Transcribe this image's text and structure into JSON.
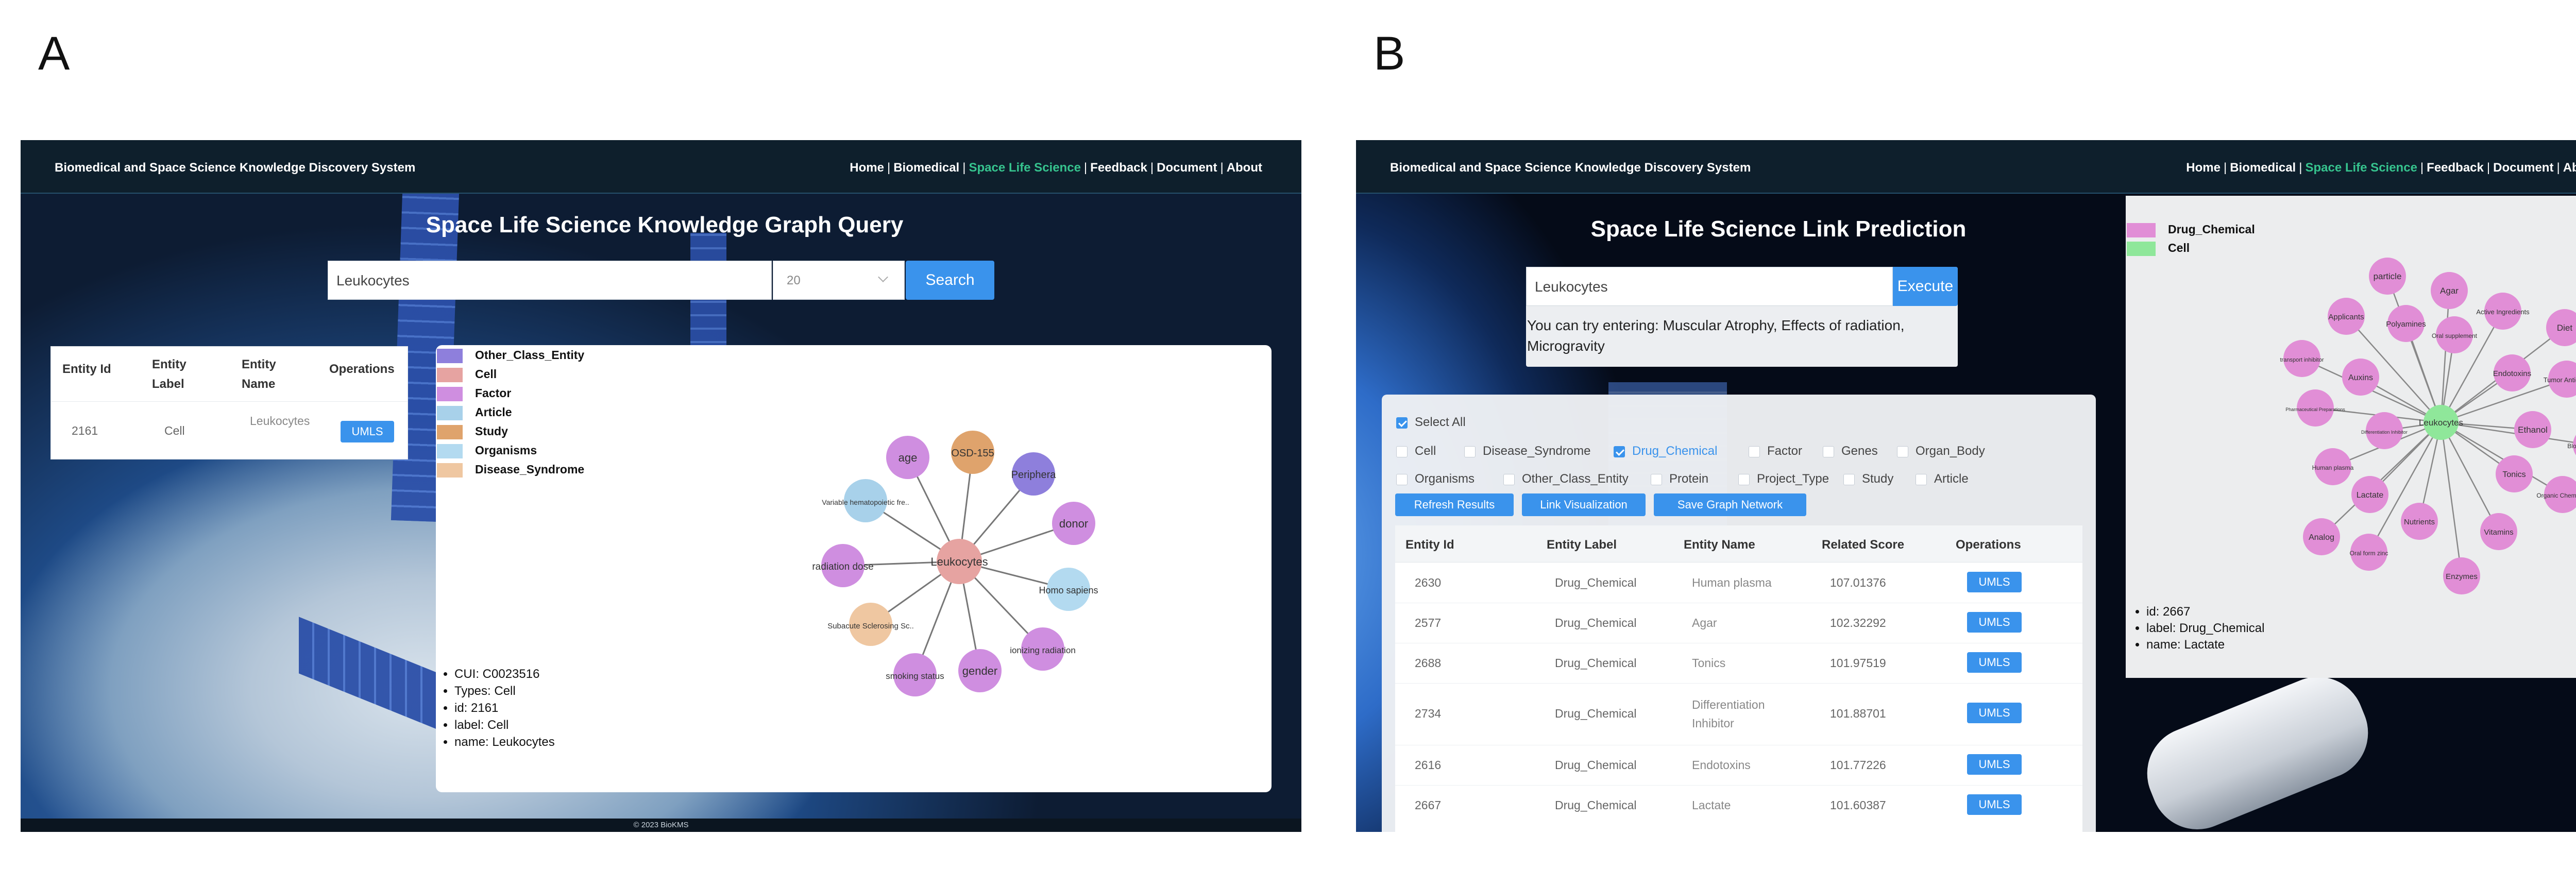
{
  "panels": {
    "a_letter": "A",
    "b_letter": "B"
  },
  "site": {
    "title": "Biomedical and Space Science Knowledge Discovery System",
    "nav": [
      "Home",
      "Biomedical",
      "Space Life Science",
      "Feedback",
      "Document",
      "About"
    ],
    "nav_active": "Space Life Science",
    "footer": "© 2023 BioKMS"
  },
  "colors": {
    "accent": "#3a93ec",
    "nav_active": "#36c38e",
    "topbar": "#0e1f2c",
    "Other_Class_Entity": "#8e7fdc",
    "Cell": "#e6a3a1",
    "Factor": "#cf8ee0",
    "Article": "#a8d1ea",
    "Study": "#dfa36c",
    "Organisms": "#b3daf0",
    "Disease_Syndrome": "#efc7a1",
    "Drug_Chemical": "#e18ed6",
    "CellB": "#8fe79a"
  },
  "panel_a": {
    "page_title": "Space Life Science Knowledge Graph Query",
    "search_value": "Leukocytes",
    "limit_value": "20",
    "search_button": "Search",
    "result_table": {
      "headers": [
        "Entity Id",
        "Entity Label",
        "Entity Name",
        "Operations"
      ],
      "rows": [
        {
          "id": "2161",
          "label": "Cell",
          "name": "Leukocytes",
          "op": "UMLS"
        }
      ]
    },
    "legend": [
      {
        "label": "Other_Class_Entity",
        "color": "#8e7fdc"
      },
      {
        "label": "Cell",
        "color": "#e6a3a1"
      },
      {
        "label": "Factor",
        "color": "#cf8ee0"
      },
      {
        "label": "Article",
        "color": "#a8d1ea"
      },
      {
        "label": "Study",
        "color": "#dfa36c"
      },
      {
        "label": "Organisms",
        "color": "#b3daf0"
      },
      {
        "label": "Disease_Syndrome",
        "color": "#efc7a1"
      }
    ],
    "graph": {
      "center": {
        "label": "Leukocytes",
        "type": "Cell"
      },
      "nodes": [
        {
          "label": "age",
          "type": "Factor"
        },
        {
          "label": "OSD-155",
          "type": "Study"
        },
        {
          "label": "Periphera",
          "type": "Other_Class_Entity"
        },
        {
          "label": "donor",
          "type": "Factor"
        },
        {
          "label": "Homo sapiens",
          "type": "Organisms"
        },
        {
          "label": "ionizing radiation",
          "type": "Factor"
        },
        {
          "label": "gender",
          "type": "Factor"
        },
        {
          "label": "smoking status",
          "type": "Factor"
        },
        {
          "label": "Subacute Sclerosing Sc..",
          "type": "Disease_Syndrome"
        },
        {
          "label": "radiation dose",
          "type": "Factor"
        },
        {
          "label": "Variable hematopoietic fre..",
          "type": "Article"
        }
      ]
    },
    "info": [
      "CUI: C0023516",
      "Types: Cell",
      "id: 2161",
      "label: Cell",
      "name: Leukocytes"
    ]
  },
  "panel_b": {
    "page_title": "Space Life Science Link Prediction",
    "search_value": "Leukocytes",
    "execute_button": "Execute",
    "hint": "You can try entering: Muscular Atrophy, Effects of radiation, Microgravity",
    "select_all": "Select All",
    "filters_row1": [
      {
        "label": "Cell",
        "checked": false
      },
      {
        "label": "Disease_Syndrome",
        "checked": false
      },
      {
        "label": "Drug_Chemical",
        "checked": true
      },
      {
        "label": "Factor",
        "checked": false
      },
      {
        "label": "Genes",
        "checked": false
      },
      {
        "label": "Organ_Body",
        "checked": false
      }
    ],
    "filters_row2": [
      {
        "label": "Organisms",
        "checked": false
      },
      {
        "label": "Other_Class_Entity",
        "checked": false
      },
      {
        "label": "Protein",
        "checked": false
      },
      {
        "label": "Project_Type",
        "checked": false
      },
      {
        "label": "Study",
        "checked": false
      },
      {
        "label": "Article",
        "checked": false
      }
    ],
    "buttons": [
      "Refresh Results",
      "Link Visualization",
      "Save Graph Network"
    ],
    "table": {
      "headers": [
        "Entity Id",
        "Entity Label",
        "Entity Name",
        "Related Score",
        "Operations"
      ],
      "rows": [
        {
          "id": "2630",
          "label": "Drug_Chemical",
          "name": "Human plasma",
          "score": "107.01376",
          "op": "UMLS"
        },
        {
          "id": "2577",
          "label": "Drug_Chemical",
          "name": "Agar",
          "score": "102.32292",
          "op": "UMLS"
        },
        {
          "id": "2688",
          "label": "Drug_Chemical",
          "name": "Tonics",
          "score": "101.97519",
          "op": "UMLS"
        },
        {
          "id": "2734",
          "label": "Drug_Chemical",
          "name": "Differentiation Inhibitor",
          "score": "101.88701",
          "op": "UMLS"
        },
        {
          "id": "2616",
          "label": "Drug_Chemical",
          "name": "Endotoxins",
          "score": "101.77226",
          "op": "UMLS"
        },
        {
          "id": "2667",
          "label": "Drug_Chemical",
          "name": "Lactate",
          "score": "101.60387",
          "op": "UMLS"
        }
      ]
    },
    "close_icon": "×",
    "legend": [
      {
        "label": "Drug_Chemical",
        "color": "#e18ed6"
      },
      {
        "label": "Cell",
        "color": "#8fe79a"
      }
    ],
    "graph": {
      "center": {
        "label": "Leukocytes"
      },
      "nodes": [
        "particle",
        "Agar",
        "Active Ingredients",
        "Diet",
        "Tumor Antigens",
        "Blood Substitutes",
        "Ethanol",
        "Endotoxins",
        "Oral supplement",
        "Polyamines",
        "Applicants",
        "transport inhibitor",
        "Auxins",
        "Pharmaceutical Preparations",
        "Differentiation Inhibitor",
        "Human plasma",
        "Lactate",
        "Analog",
        "Oral form zinc",
        "Nutrients",
        "Enzymes",
        "Vitamins",
        "Tonics",
        "Organic Chemicals"
      ]
    },
    "info": [
      "id: 2667",
      "label: Drug_Chemical",
      "name: Lactate"
    ]
  }
}
